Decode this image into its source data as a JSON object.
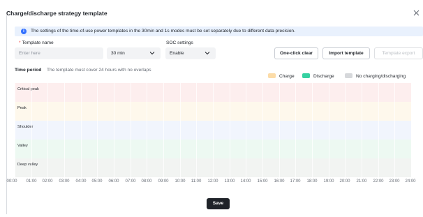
{
  "dialog": {
    "title": "Charge/discharge strategy template",
    "close_icon": "close-icon"
  },
  "notice": {
    "icon": "info-icon",
    "icon_glyph": "i",
    "text": "The settings of the time-of-use power templates in the 30min and 1s modes must be set separately due to different data precision."
  },
  "form": {
    "template_name_label": "Template name",
    "required_mark": "*",
    "template_name_placeholder": "Enter here",
    "interval_value": "30 min",
    "soc_label": "SOC settings",
    "soc_value": "Enable"
  },
  "actions": {
    "one_click_clear": "One-click clear",
    "import_template": "Import template",
    "template_export": "Template export"
  },
  "time_period": {
    "title": "Time period",
    "hint": "The template must cover 24 hours with no overlaps"
  },
  "legend": [
    {
      "label": "Charge",
      "color": "#fcdca8"
    },
    {
      "label": "Discharge",
      "color": "#36d1a1"
    },
    {
      "label": "No charging/discharging",
      "color": "#d6d8db"
    }
  ],
  "rows": [
    {
      "label": "Critical peak",
      "color": "#fdeeee"
    },
    {
      "label": "Peak",
      "color": "#fef8ec"
    },
    {
      "label": "Shoulder",
      "color": "#f1f5fd"
    },
    {
      "label": "Valley",
      "color": "#edf9f2"
    },
    {
      "label": "Deep valley",
      "color": "#f2f4f2"
    }
  ],
  "time_ticks": [
    "00:00",
    "01:00",
    "02:00",
    "03:00",
    "04:00",
    "05:00",
    "06:00",
    "07:00",
    "08:00",
    "09:00",
    "10:00",
    "11:00",
    "12:00",
    "13:00",
    "14:00",
    "15:00",
    "16:00",
    "17:00",
    "18:00",
    "19:00",
    "20:00",
    "21:00",
    "22:00",
    "23:00",
    "24:00"
  ],
  "footer": {
    "save": "Save"
  },
  "colors": {
    "accent": "#3370ff",
    "primary_button": "#1f2329",
    "notice_bg": "#e9f1fd"
  }
}
